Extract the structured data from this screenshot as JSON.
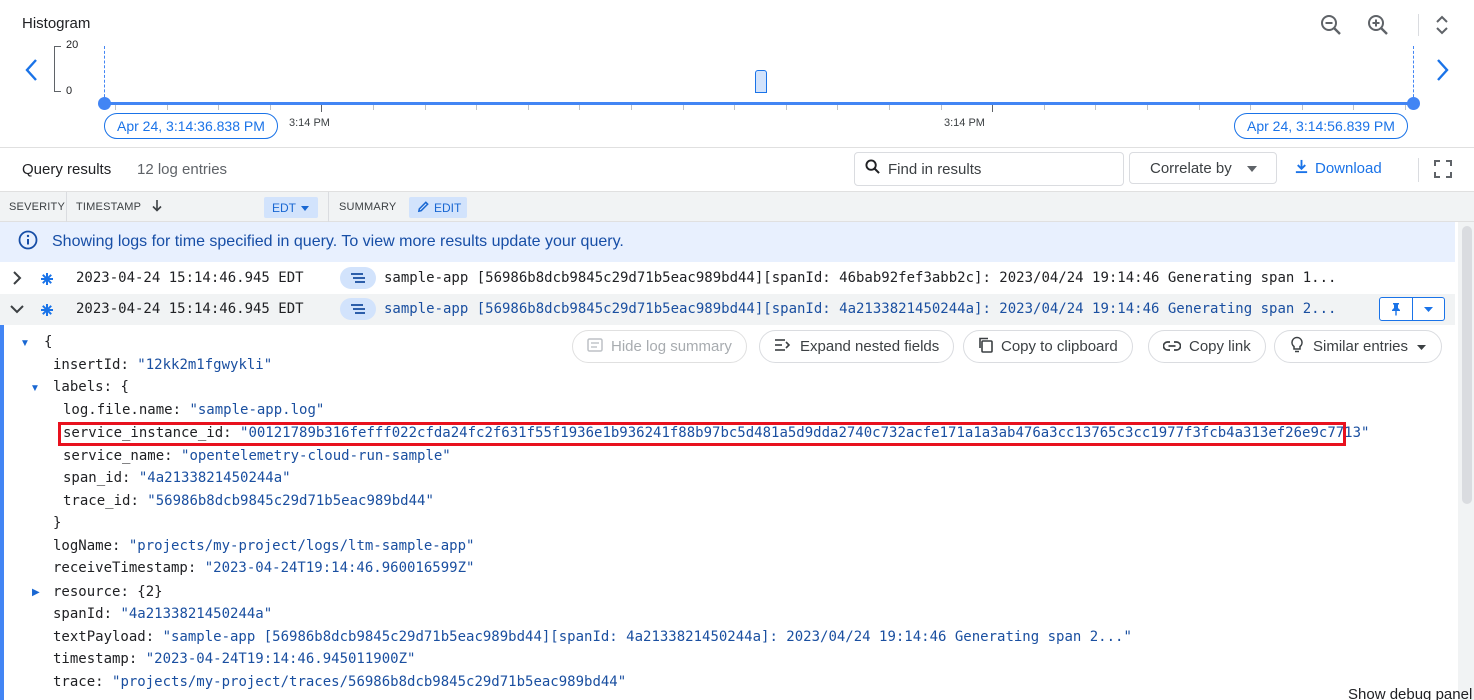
{
  "histogram": {
    "title": "Histogram",
    "y_max": "20",
    "y_min": "0",
    "tick_left": "3:14 PM",
    "tick_right": "3:14 PM",
    "start_chip": "Apr 24, 3:14:36.838 PM",
    "end_chip": "Apr 24, 3:14:56.839 PM"
  },
  "toolbar": {
    "title": "Query results",
    "count": "12 log entries",
    "find_placeholder": "Find in results",
    "correlate_label": "Correlate by",
    "download_label": "Download"
  },
  "columns": {
    "severity": "SEVERITY",
    "timestamp": "TIMESTAMP",
    "tz_chip": "EDT",
    "summary": "SUMMARY",
    "edit_chip": "EDIT"
  },
  "banner": {
    "text": "Showing logs for time specified in query. To view more results update your query."
  },
  "rows": [
    {
      "timestamp": "2023-04-24 15:14:46.945 EDT",
      "summary": "sample-app [56986b8dcb9845c29d71b5eac989bd44][spanId: 46bab92fef3abb2c]: 2023/04/24 19:14:46 Generating span 1..."
    },
    {
      "timestamp": "2023-04-24 15:14:46.945 EDT",
      "summary": "sample-app [56986b8dcb9845c29d71b5eac989bd44][spanId: 4a2133821450244a]: 2023/04/24 19:14:46 Generating span 2..."
    }
  ],
  "detail_actions": {
    "hide_summary": "Hide log summary",
    "expand_nested": "Expand nested fields",
    "copy_clipboard": "Copy to clipboard",
    "copy_link": "Copy link",
    "similar": "Similar entries"
  },
  "json_lines": {
    "open_brace": "{",
    "insertId_key": "insertId",
    "insertId_val": "\"12kk2m1fgwykli\"",
    "labels_key": "labels",
    "labels_open": "{",
    "logfile_key": "log.file.name",
    "logfile_val": "\"sample-app.log\"",
    "sid_key": "service_instance_id",
    "sid_val": "\"00121789b316fefff022cfda24fc2f631f55f1936e1b936241f88b97bc5d481a5d9dda2740c732acfe171a1a3ab476a3cc13765c3cc1977f3fcb4a313ef26e9c7713\"",
    "sname_key": "service_name",
    "sname_val": "\"opentelemetry-cloud-run-sample\"",
    "span_key": "span_id",
    "span_val": "\"4a2133821450244a\"",
    "trace_key": "trace_id",
    "trace_val": "\"56986b8dcb9845c29d71b5eac989bd44\"",
    "labels_close": "}",
    "logname_key": "logName",
    "logname_val": "\"projects/my-project/logs/ltm-sample-app\"",
    "recv_key": "receiveTimestamp",
    "recv_val": "\"2023-04-24T19:14:46.960016599Z\"",
    "resource_key": "resource",
    "resource_val": "{2}",
    "spanId_key": "spanId",
    "spanId_val": "\"4a2133821450244a\"",
    "text_key": "textPayload",
    "text_val": "\"sample-app [56986b8dcb9845c29d71b5eac989bd44][spanId: 4a2133821450244a]: 2023/04/24 19:14:46 Generating span 2...\"",
    "ts_key": "timestamp",
    "ts_val": "\"2023-04-24T19:14:46.945011900Z\"",
    "tr_key": "trace",
    "tr_val": "\"projects/my-project/traces/56986b8dcb9845c29d71b5eac989bd44\""
  },
  "debug_label": "Show debug panel",
  "colors": {
    "accent": "#1a73e8",
    "banner_bg": "#e8f0fe",
    "highlight": "#e8111e"
  }
}
